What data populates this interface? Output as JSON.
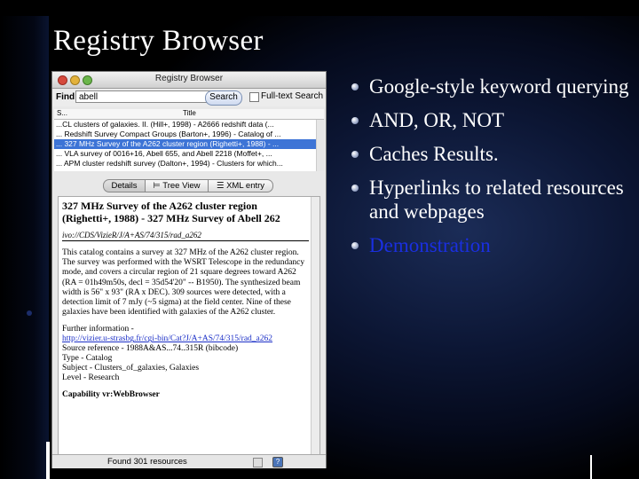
{
  "slide": {
    "title": "Registry Browser",
    "bullets": [
      "Google-style keyword querying",
      "AND, OR, NOT",
      "Caches Results.",
      "Hyperlinks to related resources and webpages",
      "Demonstration"
    ]
  },
  "window": {
    "title": "Registry Browser",
    "find_label": "Find:",
    "find_value": "abell",
    "search_label": "Search",
    "fulltext_label": "Full-text Search",
    "columns": {
      "s": "S...",
      "title": "Title"
    },
    "rows": [
      "...CL clusters of galaxies. II. (Hill+, 1998) - A2666 redshift data (...",
      "... Redshift Survey Compact Groups (Barton+, 1996) - Catalog of ...",
      "... 327 MHz Survey of the A262 cluster region (Righetti+, 1988) - ...",
      "... VLA survey of 0016+16, Abell 655, and Abell 2218 (Moffet+, ...",
      "... APM cluster redshift survey (Dalton+, 1994) - Clusters for which..."
    ],
    "tabs": {
      "details": "Details",
      "tree": "Tree View",
      "xml": "XML entry"
    },
    "detail": {
      "title": "327 MHz Survey of the A262 cluster region (Righetti+, 1988) - 327 MHz Survey of Abell 262",
      "ivo_id": "ivo://CDS/VizieR/J/A+AS/74/315/rad_a262",
      "description": "This catalog contains a survey at 327 MHz of the A262 cluster region. The survey was performed with the WSRT Telescope in the redundancy mode, and covers a circular region of 21 square degrees toward A262 (RA = 01h49m50s, decl = 35d54'20\" -- B1950). The synthesized beam width is 56\" x 93\" (RA x DEC). 309 sources were detected, with a detection limit of 7 mJy (~5 sigma) at the field center. Nine of these galaxies have been identified with galaxies of the A262 cluster.",
      "further_info_label": "Further information -",
      "further_info_url": "http://vizier.u-strasbg.fr/cgi-bin/Cat?J/A+AS/74/315/rad_a262",
      "source_ref": "Source reference - 1988A&AS...74..315R (bibcode)",
      "type": "Type - Catalog",
      "subject": "Subject - Clusters_of_galaxies, Galaxies",
      "level": "Level - Research",
      "capability": "Capability vr:WebBrowser"
    },
    "status": "Found 301 resources",
    "help_glyph": "?"
  },
  "colors": {
    "selection": "#3d74d6",
    "link": "#1b2fc7",
    "demo_link": "#1a2fe0"
  }
}
